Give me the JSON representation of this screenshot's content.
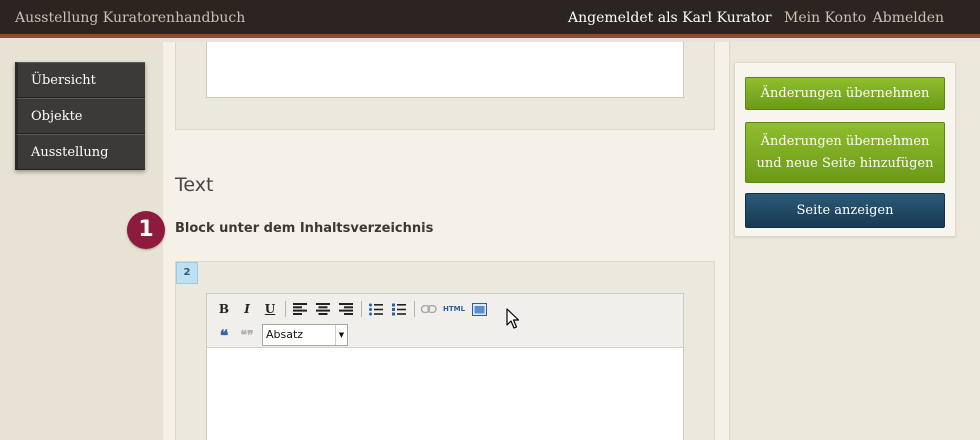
{
  "header": {
    "app_title": "Ausstellung Kuratorenhandbuch",
    "logged_in": "Angemeldet als Karl Kurator",
    "account_link": "Mein Konto",
    "logout_link": "Abmelden"
  },
  "sidebar": {
    "items": [
      {
        "label": "Übersicht"
      },
      {
        "label": "Objekte"
      },
      {
        "label": "Ausstellung"
      }
    ]
  },
  "main": {
    "section_title": "Text",
    "step_badge": "1",
    "block_label": "Block unter dem Inhaltsverzeichnis",
    "block_number": "2",
    "editor": {
      "bold": "B",
      "italic": "I",
      "underline": "U",
      "html": "HTML",
      "format_select": "Absatz"
    }
  },
  "actions": {
    "save": "Änderungen übernehmen",
    "save_add_line1": "Änderungen übernehmen",
    "save_add_line2": "und neue Seite hinzufügen",
    "view_page": "Seite anzeigen"
  },
  "colors": {
    "topbar": "#2b2420",
    "accent_border": "#8a4a34",
    "badge": "#8e1a3d",
    "green_button": "#7aa823",
    "blue_button": "#1f4864"
  }
}
